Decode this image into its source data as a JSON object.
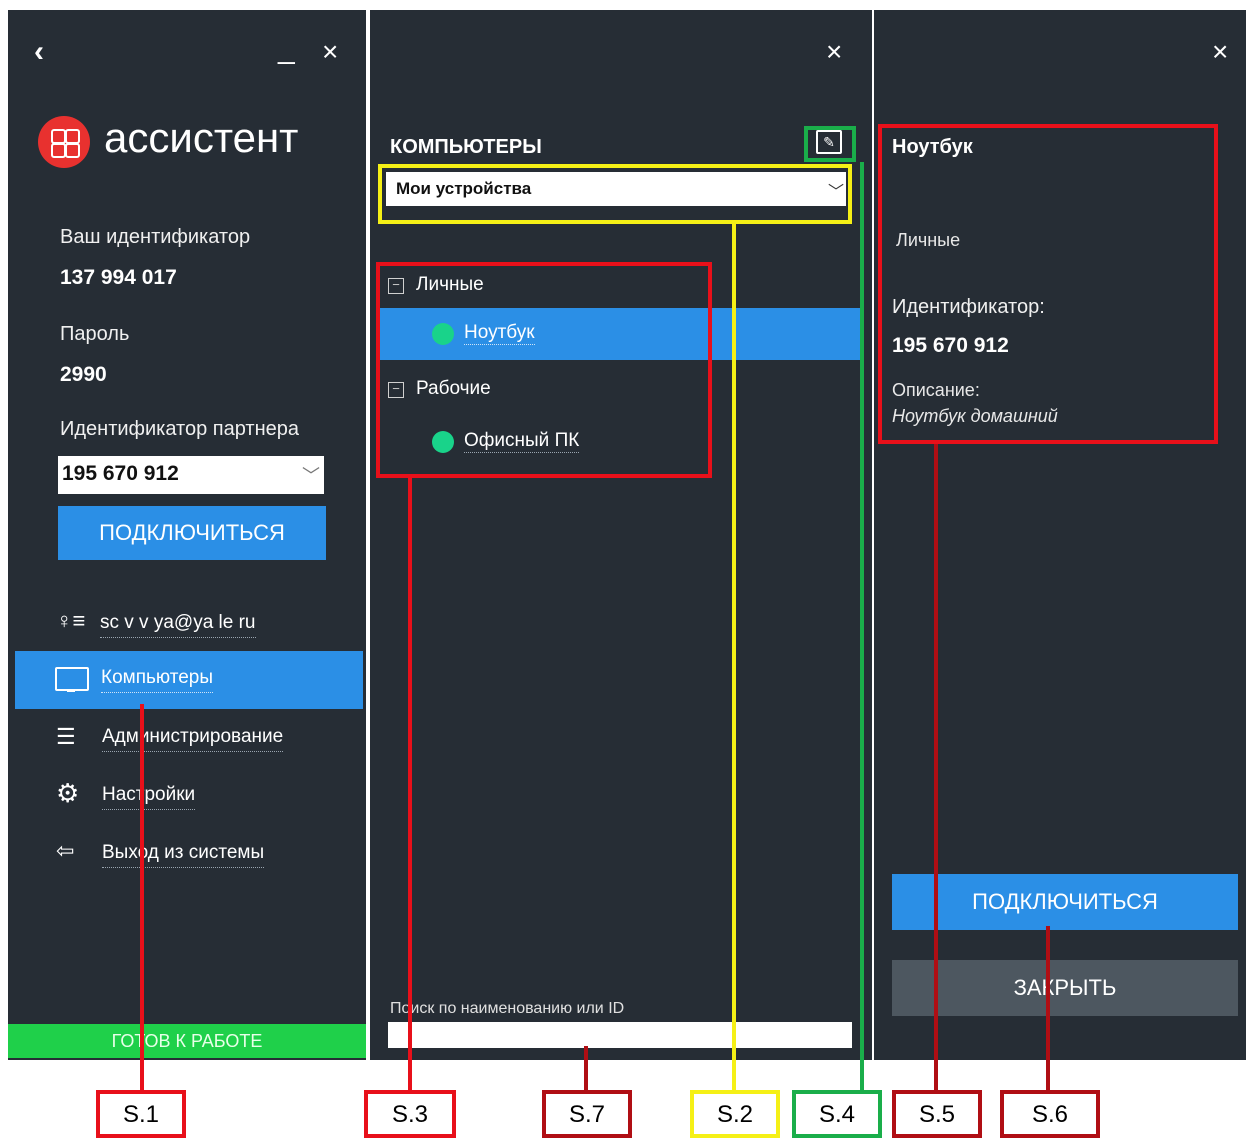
{
  "left_panel": {
    "back": "‹",
    "minimize": "_",
    "close": "×",
    "logo_text": "ассистент",
    "your_id_label": "Ваш идентификатор",
    "your_id": "137 994 017",
    "password_label": "Пароль",
    "password": "2990",
    "partner_label": "Идентификатор партнера",
    "partner_value": "195 670 912",
    "connect_button": "ПОДКЛЮЧИТЬСЯ",
    "menu": {
      "account": "sc  v  v  ya@ya  le  ru",
      "computers": "Компьютеры",
      "admin": "Администрирование",
      "settings": "Настройки",
      "logout": "Выход из системы"
    },
    "status": "ГОТОВ К РАБОТЕ",
    "colors": {
      "bg": "#262d35",
      "accent": "#2b8fe6",
      "status": "#1fd04a"
    }
  },
  "middle_panel": {
    "close": "×",
    "title": "КОМПЬЮТЕРЫ",
    "filter_value": "Мои устройства",
    "groups": [
      {
        "expander": "−",
        "name": "Личные",
        "devices": [
          {
            "name": "Ноутбук",
            "selected": true,
            "status": "online"
          }
        ]
      },
      {
        "expander": "−",
        "name": "Рабочие",
        "devices": [
          {
            "name": "Офисный ПК",
            "selected": false,
            "status": "online"
          }
        ]
      }
    ],
    "search_label": "Поиск по наименованию или ID",
    "search_value": ""
  },
  "right_panel": {
    "close": "×",
    "device_name": "Ноутбук",
    "group": "Личные",
    "id_label": "Идентификатор:",
    "id_value": "195 670 912",
    "desc_label": "Описание:",
    "desc_value": "Ноутбук домашний",
    "connect_button": "ПОДКЛЮЧИТЬСЯ",
    "close_button": "ЗАКРЫТЬ"
  },
  "annotations": {
    "s1": "S.1",
    "s2": "S.2",
    "s3": "S.3",
    "s4": "S.4",
    "s5": "S.5",
    "s6": "S.6",
    "s7": "S.7",
    "colors": {
      "red": "#e8101a",
      "darkred": "#b00e14",
      "yellow": "#f5f016",
      "green": "#1aae4a"
    }
  }
}
